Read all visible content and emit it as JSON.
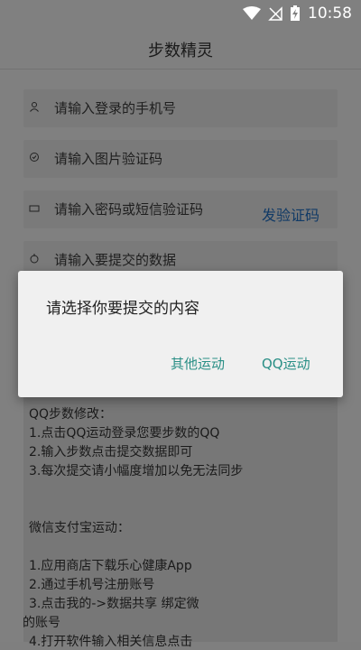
{
  "status_bar": {
    "time": "10:58",
    "icons": [
      "wifi-icon",
      "no-signal-icon",
      "battery-charging-icon"
    ]
  },
  "app_bar": {
    "title": "步数精灵"
  },
  "form": {
    "phone_placeholder": "请输入登录的手机号",
    "captcha_placeholder": "请输入图片验证码",
    "password_placeholder": "请输入密码或短信验证码",
    "send_code_label": "发验证码",
    "steps_placeholder": "请输入要提交的数据"
  },
  "instructions": [
    "QQ步数修改：",
    "1.点击QQ运动登录您要步数的QQ",
    "2.输入步数点击提交数据即可",
    "3.每次提交请小幅度增加以免无法同步",
    "",
    "微信支付宝运动：",
    "",
    "1.应用商店下载乐心健康App",
    "2.通过手机号注册账号",
    "3.点击我的->数据共享 绑定微",
    "的账号",
    "4.打开软件输入相关信息点击"
  ],
  "dialog": {
    "title": "请选择你要提交的内容",
    "option_other": "其他运动",
    "option_qq": "QQ运动"
  }
}
